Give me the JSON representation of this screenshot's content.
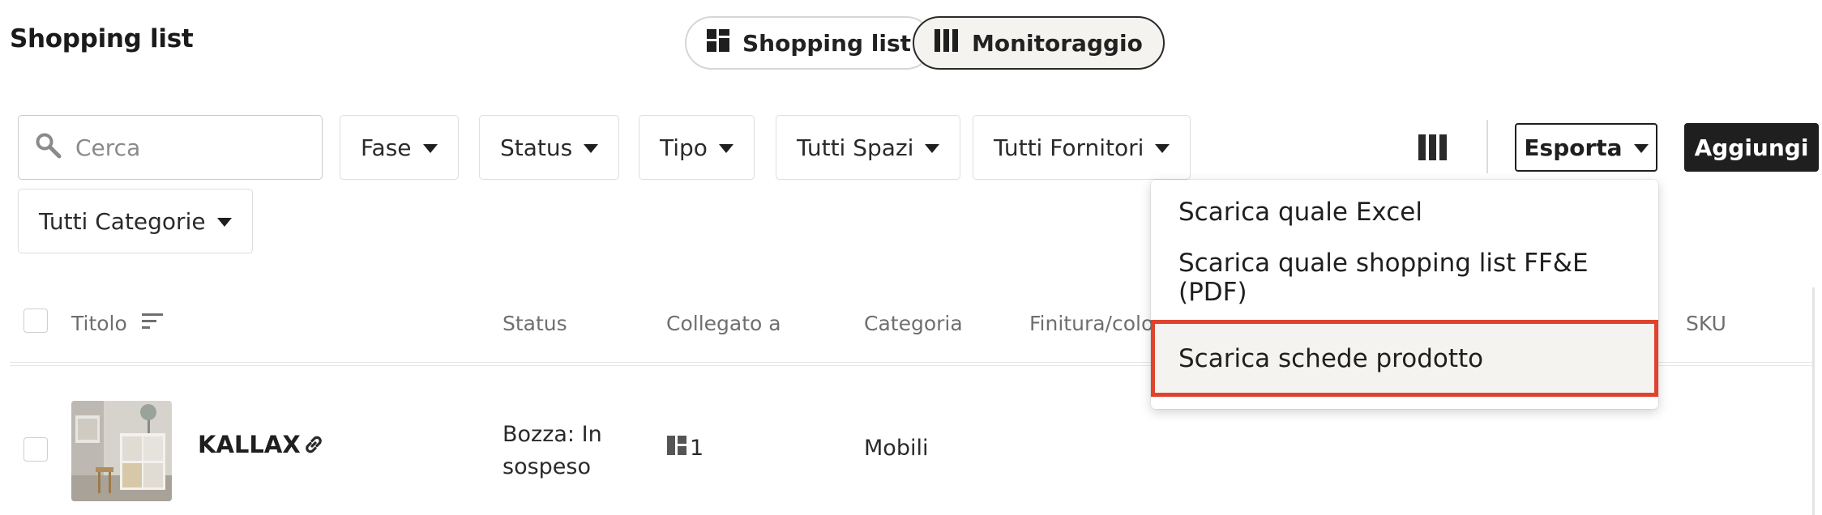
{
  "page": {
    "title": "Shopping list"
  },
  "view_toggle": {
    "shopping_label": "Shopping list",
    "monitor_label": "Monitoraggio",
    "active": "Monitoraggio"
  },
  "search": {
    "placeholder": "Cerca",
    "value": ""
  },
  "filters": [
    {
      "label": "Fase"
    },
    {
      "label": "Status"
    },
    {
      "label": "Tipo"
    },
    {
      "label": "Tutti Spazi"
    },
    {
      "label": "Tutti Fornitori"
    },
    {
      "label": "Tutti Categorie"
    }
  ],
  "toolbar": {
    "export_label": "Esporta",
    "add_label": "Aggiungi"
  },
  "export_menu": {
    "items": [
      {
        "label": "Scarica quale Excel"
      },
      {
        "label": "Scarica quale shopping list FF&E (PDF)"
      },
      {
        "label": "Scarica schede prodotto"
      }
    ],
    "highlighted_index": 2
  },
  "table": {
    "columns": [
      "Titolo",
      "Status",
      "Collegato a",
      "Categoria",
      "Finitura/colo",
      "SKU"
    ],
    "rows": [
      {
        "title": "KALLAX",
        "status_line1": "Bozza: In",
        "status_line2": "sospeso",
        "linked_count": "1",
        "category": "Mobili"
      }
    ]
  },
  "colors": {
    "accent_dark": "#1f1f1f",
    "highlight_border": "#e0432d",
    "active_toggle_bg": "#f5f3ef"
  },
  "icons": [
    "grid-icon",
    "columns-icon",
    "search-icon",
    "caret-down-icon",
    "sort-icon",
    "link-icon",
    "linked-item-icon"
  ]
}
